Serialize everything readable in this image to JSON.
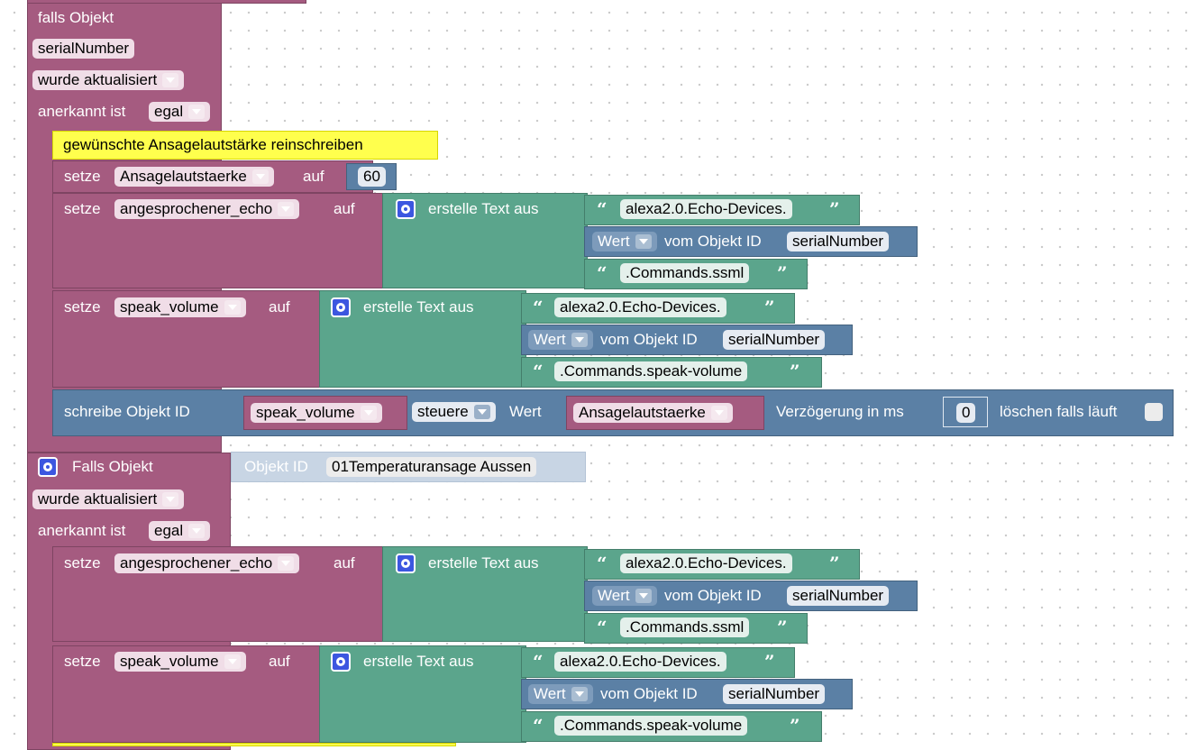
{
  "block1": {
    "trigger_label": "falls Objekt",
    "object_var": "serialNumber",
    "event_option": "wurde aktualisiert",
    "ack_label": "anerkannt ist",
    "ack_value": "egal",
    "comment": "gewünschte Ansagelautstärke reinschreiben",
    "set1": {
      "setze": "setze",
      "var": "Ansagelautstaerke",
      "auf": "auf",
      "value": "60"
    },
    "set2": {
      "setze": "setze",
      "var": "angesprochener_echo",
      "auf": "auf",
      "join_label": "erstelle Text aus",
      "part1": "alexa2.0.Echo-Devices.",
      "wert": "Wert",
      "vom": "vom Objekt ID",
      "obj": "serialNumber",
      "part3": ".Commands.ssml"
    },
    "set3": {
      "setze": "setze",
      "var": "speak_volume",
      "auf": "auf",
      "join_label": "erstelle Text aus",
      "part1": "alexa2.0.Echo-Devices.",
      "wert": "Wert",
      "vom": "vom Objekt ID",
      "obj": "serialNumber",
      "part3": ".Commands.speak-volume"
    },
    "write": {
      "label": "schreibe  Objekt ID",
      "obj": "speak_volume",
      "mode": "steuere",
      "wert": "Wert",
      "value": "Ansagelautstaerke",
      "delay_label": "Verzögerung in ms",
      "delay": "0",
      "clear_label": "löschen falls läuft"
    }
  },
  "block2": {
    "trigger_label": "Falls Objekt",
    "objid_label": "Objekt ID",
    "objid_value": "01Temperaturansage Aussen",
    "event_option": "wurde aktualisiert",
    "ack_label": "anerkannt ist",
    "ack_value": "egal",
    "set2": {
      "setze": "setze",
      "var": "angesprochener_echo",
      "auf": "auf",
      "join_label": "erstelle Text aus",
      "part1": "alexa2.0.Echo-Devices.",
      "wert": "Wert",
      "vom": "vom Objekt ID",
      "obj": "serialNumber",
      "part3": ".Commands.ssml"
    },
    "set3": {
      "setze": "setze",
      "var": "speak_volume",
      "auf": "auf",
      "join_label": "erstelle Text aus",
      "part1": "alexa2.0.Echo-Devices.",
      "wert": "Wert",
      "vom": "vom Objekt ID",
      "obj": "serialNumber",
      "part3": ".Commands.speak-volume"
    }
  },
  "quote_open": "“",
  "quote_close": "”",
  "colors": {
    "event": "#a55b80",
    "text": "#5ba58c",
    "object": "#5b80a5",
    "comment": "#ffff4d"
  }
}
